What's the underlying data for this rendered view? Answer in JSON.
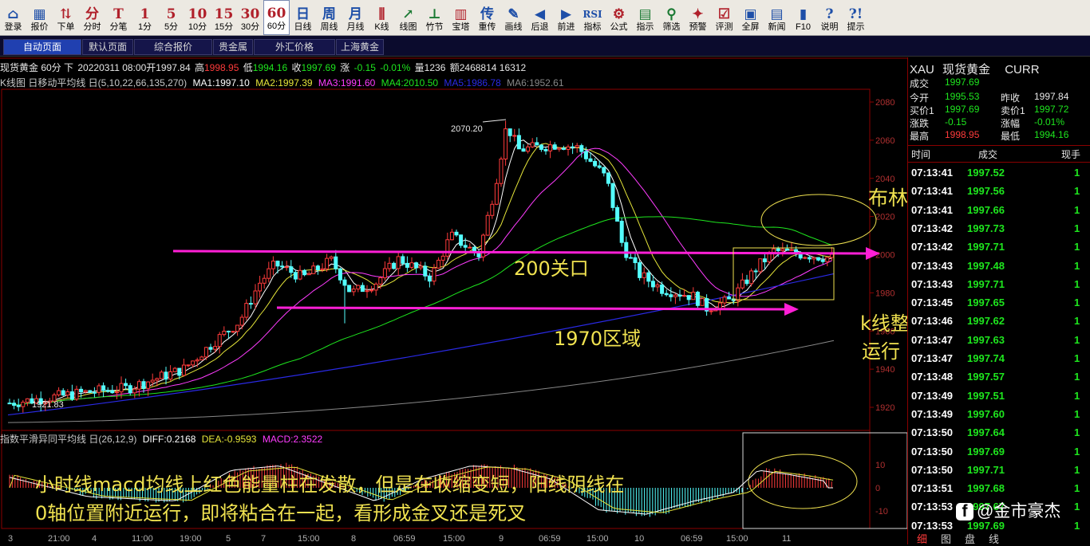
{
  "toolbar": [
    {
      "icon": "login-icon",
      "label": "登录",
      "glyph": "⌂",
      "color": "blue"
    },
    {
      "icon": "quote-icon",
      "label": "报价",
      "glyph": "▦",
      "color": "blue"
    },
    {
      "icon": "order-icon",
      "label": "下单",
      "glyph": "⇅",
      "color": "red"
    },
    {
      "icon": "minute-chart-icon",
      "label": "分时",
      "glyph": "分",
      "color": "red"
    },
    {
      "icon": "tick-icon",
      "label": "分笔",
      "glyph": "T",
      "color": "red"
    },
    {
      "icon": "period-1m-icon",
      "label": "1分",
      "glyph": "1",
      "color": "red"
    },
    {
      "icon": "period-5m-icon",
      "label": "5分",
      "glyph": "5",
      "color": "red"
    },
    {
      "icon": "period-10m-icon",
      "label": "10分",
      "glyph": "10",
      "color": "red"
    },
    {
      "icon": "period-15m-icon",
      "label": "15分",
      "glyph": "15",
      "color": "red"
    },
    {
      "icon": "period-30m-icon",
      "label": "30分",
      "glyph": "30",
      "color": "red"
    },
    {
      "icon": "period-60m-icon",
      "label": "60分",
      "glyph": "60",
      "color": "red"
    },
    {
      "icon": "daily-icon",
      "label": "日线",
      "glyph": "日",
      "color": "blue"
    },
    {
      "icon": "weekly-icon",
      "label": "周线",
      "glyph": "周",
      "color": "blue"
    },
    {
      "icon": "monthly-icon",
      "label": "月线",
      "glyph": "月",
      "color": "blue"
    },
    {
      "icon": "candlestick-icon",
      "label": "K线",
      "glyph": "⫼",
      "color": "red"
    },
    {
      "icon": "line-chart-icon",
      "label": "线图",
      "glyph": "↗",
      "color": "green"
    },
    {
      "icon": "bamboo-icon",
      "label": "竹节",
      "glyph": "⊥",
      "color": "green"
    },
    {
      "icon": "tower-icon",
      "label": "宝塔",
      "glyph": "▥",
      "color": "red"
    },
    {
      "icon": "overlay-icon",
      "label": "重传",
      "glyph": "传",
      "color": "blue"
    },
    {
      "icon": "draw-line-icon",
      "label": "画线",
      "glyph": "✎",
      "color": "blue"
    },
    {
      "icon": "back-icon",
      "label": "后退",
      "glyph": "◀",
      "color": "blue"
    },
    {
      "icon": "forward-icon",
      "label": "前进",
      "glyph": "▶",
      "color": "blue"
    },
    {
      "icon": "indicator-icon",
      "label": "指标",
      "glyph": "RSI",
      "color": "blue"
    },
    {
      "icon": "formula-icon",
      "label": "公式",
      "glyph": "⚙",
      "color": "red"
    },
    {
      "icon": "hint-icon",
      "label": "指示",
      "glyph": "▤",
      "color": "green"
    },
    {
      "icon": "filter-icon",
      "label": "筛选",
      "glyph": "⚲",
      "color": "green"
    },
    {
      "icon": "alert-icon",
      "label": "预警",
      "glyph": "✦",
      "color": "red"
    },
    {
      "icon": "evaluate-icon",
      "label": "评测",
      "glyph": "☑",
      "color": "red"
    },
    {
      "icon": "fullscreen-icon",
      "label": "全屏",
      "glyph": "▣",
      "color": "blue"
    },
    {
      "icon": "news-icon",
      "label": "新闻",
      "glyph": "▤",
      "color": "blue"
    },
    {
      "icon": "f10-icon",
      "label": "F10",
      "glyph": "▮",
      "color": "blue"
    },
    {
      "icon": "manual-icon",
      "label": "说明",
      "glyph": "?",
      "color": "blue"
    },
    {
      "icon": "tips-icon",
      "label": "提示",
      "glyph": "?!",
      "color": "blue"
    }
  ],
  "tabs": [
    "自动页面",
    "默认页面",
    "综合报价",
    "贵金属",
    "外汇价格",
    "上海黄金"
  ],
  "info_line": {
    "product": "现货黄金 60分 下",
    "date_open_label": "20220311 08:00开",
    "open": "1997.84",
    "high_label": "高",
    "high": "1998.95",
    "low_label": "低",
    "low": "1994.16",
    "close_label": "收",
    "close": "1997.69",
    "change_label": "涨",
    "change": "-0.15",
    "change_pct": "-0.01%",
    "volume": "量1236",
    "amount": "额2468814 16312"
  },
  "ma_line": {
    "title": "K线图 日移动平均线 日(5,10,22,66,135,270)",
    "ma1": "MA1:1997.10",
    "ma2": "MA2:1997.39",
    "ma3": "MA3:1991.60",
    "ma4": "MA4:2010.50",
    "ma5": "MA5:1986.78",
    "ma6": "MA6:1952.61"
  },
  "macd_line": {
    "title": "指数平滑异同平均线 日(26,12,9)",
    "diff": "DIFF:0.2168",
    "dea": "DEA:-0.9593",
    "macd": "MACD:2.3522"
  },
  "price_axis": [
    "2080",
    "2060",
    "2040",
    "2020",
    "2000",
    "1980",
    "1960",
    "1940",
    "1920"
  ],
  "macd_axis": [
    "10",
    "0",
    "-10"
  ],
  "time_axis": [
    "3",
    "21:00",
    "4",
    "11:00",
    "19:00",
    "5",
    "7",
    "15:00",
    "8",
    "06:59",
    "15:00",
    "9",
    "06:59",
    "15:00",
    "10",
    "06:59",
    "15:00",
    "11"
  ],
  "chart_marks": {
    "peak_label": "2070.20",
    "low_label": "1921.83"
  },
  "chart_data": {
    "type": "candlestick",
    "period": "60分",
    "ylim": [
      1912,
      2084
    ],
    "annotations": {
      "peak": 2070.2,
      "low": 1921.83
    },
    "resistance_line": 2000,
    "support_line": 1970
  },
  "colors": {
    "up": "#ff3b3b",
    "down": "#54ffff",
    "ma1": "#ffffff",
    "ma2": "#e6e63a",
    "ma3": "#ff3cff",
    "ma4": "#1ee61e",
    "ma5": "#2a2ae6",
    "ma6": "#888888",
    "arrow": "#ff1fd6",
    "annotation": "#f0e250"
  },
  "right_panel": {
    "symbol": "XAU",
    "name": "现货黄金",
    "market": "CURR",
    "quote": [
      {
        "label": "成交",
        "value": "1997.69",
        "color": "#1ee61e"
      },
      {
        "label": "今开",
        "value": "1995.53",
        "color": "#1ee61e"
      },
      {
        "label": "昨收",
        "value": "1997.84",
        "color": "#e8e8e8"
      },
      {
        "label": "买价1",
        "value": "1997.69",
        "color": "#1ee61e"
      },
      {
        "label": "卖价1",
        "value": "1997.72",
        "color": "#1ee61e"
      },
      {
        "label": "涨跌",
        "value": "-0.15",
        "color": "#1ee61e"
      },
      {
        "label": "涨幅",
        "value": "-0.01%",
        "color": "#1ee61e"
      },
      {
        "label": "最高",
        "value": "1998.95",
        "color": "#ff3b3b"
      },
      {
        "label": "最低",
        "value": "1994.16",
        "color": "#1ee61e"
      }
    ],
    "trade_headers": [
      "时间",
      "成交",
      "现手"
    ],
    "trades": [
      {
        "time": "07:13:41",
        "price": "1997.52",
        "vol": "1"
      },
      {
        "time": "07:13:41",
        "price": "1997.56",
        "vol": "1"
      },
      {
        "time": "07:13:41",
        "price": "1997.66",
        "vol": "1"
      },
      {
        "time": "07:13:42",
        "price": "1997.73",
        "vol": "1"
      },
      {
        "time": "07:13:42",
        "price": "1997.71",
        "vol": "1"
      },
      {
        "time": "07:13:43",
        "price": "1997.48",
        "vol": "1"
      },
      {
        "time": "07:13:43",
        "price": "1997.71",
        "vol": "1"
      },
      {
        "time": "07:13:45",
        "price": "1997.65",
        "vol": "1"
      },
      {
        "time": "07:13:46",
        "price": "1997.62",
        "vol": "1"
      },
      {
        "time": "07:13:47",
        "price": "1997.63",
        "vol": "1"
      },
      {
        "time": "07:13:47",
        "price": "1997.74",
        "vol": "1"
      },
      {
        "time": "07:13:48",
        "price": "1997.57",
        "vol": "1"
      },
      {
        "time": "07:13:49",
        "price": "1997.51",
        "vol": "1"
      },
      {
        "time": "07:13:49",
        "price": "1997.60",
        "vol": "1"
      },
      {
        "time": "07:13:50",
        "price": "1997.64",
        "vol": "1"
      },
      {
        "time": "07:13:50",
        "price": "1997.69",
        "vol": "1"
      },
      {
        "time": "07:13:50",
        "price": "1997.71",
        "vol": "1"
      },
      {
        "time": "07:13:51",
        "price": "1997.68",
        "vol": "1"
      },
      {
        "time": "07:13:53",
        "price": "1997.67",
        "vol": "1"
      },
      {
        "time": "07:13:53",
        "price": "1997.69",
        "vol": "1"
      }
    ],
    "bottom_tabs": [
      "细",
      "图",
      "盘",
      "线"
    ]
  },
  "annotations": {
    "bollinger_parallel": "布林线平行运行",
    "level_2000": "200关口",
    "level_1970": "1970区域",
    "k_below_band_1": "k线整体在布林线下轨",
    "k_below_band_2": "运行",
    "macd_note_1": "小时线macd均线上红色能量柱在发散，但是在收缩变短，阳线阴线在",
    "macd_note_2": "0轴位置附近运行，即将粘合在一起，看形成金叉还是死叉"
  },
  "watermark": "@金市豪杰"
}
